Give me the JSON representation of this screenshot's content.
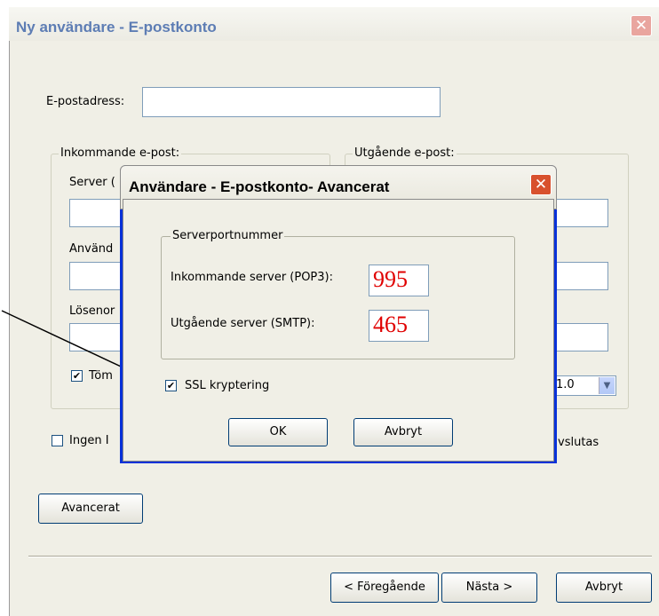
{
  "main_window": {
    "title": "Ny användare - E-postkonto",
    "close_glyph": "✕",
    "email_label": "E-postadress:",
    "email_value": "",
    "incoming_group": "Inkommande e-post:",
    "outgoing_group": "Utgående e-post:",
    "server_label_partial": "Server (",
    "user_label_partial": "Använd",
    "password_label_partial": "Lösenor",
    "empty_checkbox_partial": "Töm",
    "empty_checkbox_checked": true,
    "version_value_partial": "1.0",
    "ingen_checkbox_partial": "Ingen I",
    "ingen_checkbox_checked": false,
    "right_partial_text": "vslutas",
    "advanced_button": "Avancerat",
    "back_button": "< Föregående",
    "next_button": "Nästa >",
    "cancel_button": "Avbryt"
  },
  "dialog": {
    "title": "Användare - E-postkonto- Avancerat",
    "close_glyph": "✕",
    "group_title": "Serverportnummer",
    "incoming_label": "Inkommande server (POP3):",
    "incoming_port": "995",
    "outgoing_label": "Utgående server (SMTP):",
    "outgoing_port": "465",
    "ssl_label": "SSL kryptering",
    "ssl_checked": true,
    "ok_button": "OK",
    "cancel_button": "Avbryt"
  },
  "check_glyph": "✔",
  "colors": {
    "port_value": "#e00000",
    "dialog_frame": "#0831d9",
    "title_inactive": "#5d7db4"
  }
}
